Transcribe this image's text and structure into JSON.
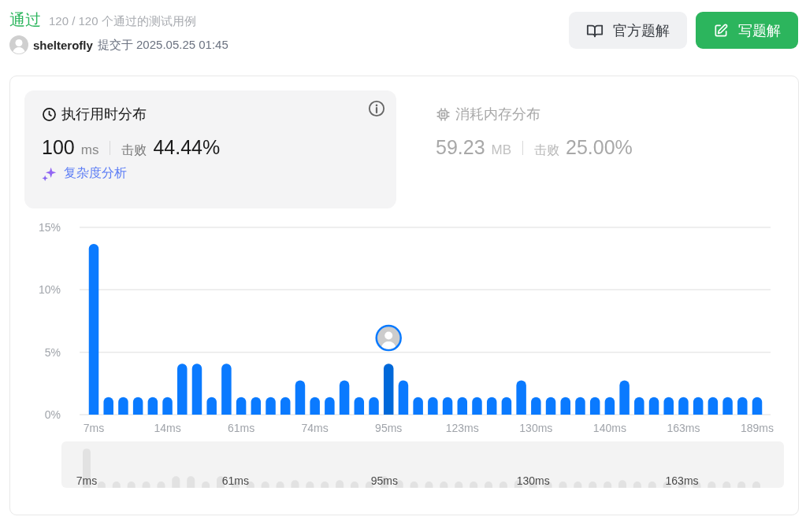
{
  "status": {
    "label": "通过",
    "detail": "120 / 120 个通过的测试用例"
  },
  "submission": {
    "username": "shelterofly",
    "submitted_text": "提交于 2025.05.25 01:45"
  },
  "buttons": [
    {
      "label": "官方题解",
      "kind": "secondary"
    },
    {
      "label": "写题解",
      "kind": "primary"
    }
  ],
  "metrics": [
    {
      "kind": "runtime",
      "title": "执行用时分布",
      "selected": true,
      "value": "100",
      "unit": "ms",
      "beats_label": "击败",
      "beats": "44.44%",
      "link": "复杂度分析"
    },
    {
      "kind": "memory",
      "title": "消耗内存分布",
      "selected": false,
      "value": "59.23",
      "unit": "MB",
      "beats_label": "击败",
      "beats": "25.00%"
    }
  ],
  "chart": {
    "chart_data": {
      "type": "bar",
      "categories": [
        "7ms",
        null,
        null,
        null,
        null,
        "14ms",
        null,
        null,
        null,
        null,
        "61ms",
        null,
        null,
        null,
        null,
        "74ms",
        null,
        null,
        null,
        null,
        "95ms",
        null,
        null,
        null,
        null,
        "123ms",
        null,
        null,
        null,
        null,
        "130ms",
        null,
        null,
        null,
        null,
        "140ms",
        null,
        null,
        null,
        null,
        "163ms",
        null,
        null,
        null,
        null,
        "189ms"
      ],
      "values": [
        13.6,
        1.33,
        1.33,
        1.33,
        1.33,
        1.33,
        4,
        4,
        1.33,
        4,
        1.33,
        1.33,
        1.33,
        1.33,
        2.67,
        1.33,
        1.33,
        2.67,
        1.33,
        1.33,
        4,
        2.67,
        1.33,
        1.33,
        1.33,
        1.33,
        1.33,
        1.33,
        1.33,
        2.67,
        1.33,
        1.33,
        1.33,
        1.33,
        1.33,
        1.33,
        2.67,
        1.33,
        1.33,
        1.33,
        1.33,
        1.33,
        1.33,
        1.33,
        1.33,
        1.33
      ],
      "ylim": [
        0,
        15
      ],
      "yticks": [
        {
          "value": 0,
          "label": "0%"
        },
        {
          "value": 5,
          "label": "5%"
        },
        {
          "value": 10,
          "label": "10%"
        },
        {
          "value": 15,
          "label": "15%"
        }
      ],
      "annotations": [
        {
          "x": "95ms"
        }
      ]
    },
    "navigator": {
      "labels": [
        "7ms",
        "61ms",
        "95ms",
        "130ms",
        "163ms"
      ]
    }
  }
}
